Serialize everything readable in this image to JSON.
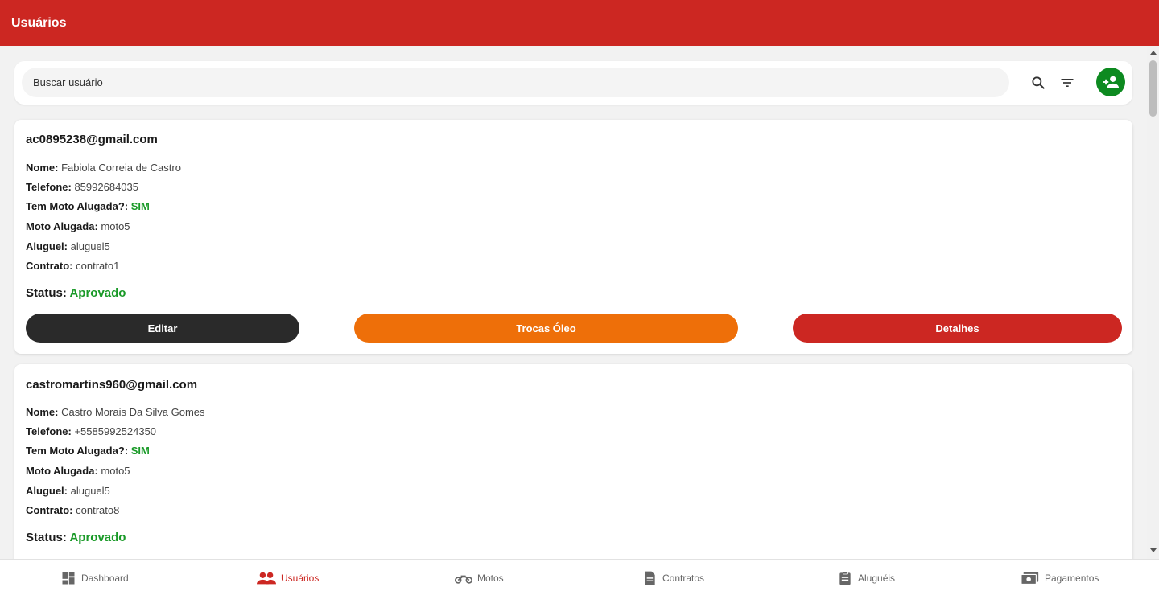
{
  "header": {
    "title": "Usuários"
  },
  "search": {
    "placeholder": "Buscar usuário"
  },
  "labels": {
    "nome": "Nome:",
    "telefone": "Telefone:",
    "tem_moto": "Tem Moto Alugada?:",
    "moto": "Moto Alugada:",
    "aluguel": "Aluguel:",
    "contrato": "Contrato:",
    "status": "Status:"
  },
  "buttons": {
    "edit": "Editar",
    "oil": "Trocas Óleo",
    "details": "Detalhes"
  },
  "users": [
    {
      "email": "ac0895238@gmail.com",
      "nome": "Fabiola Correia de Castro",
      "telefone": "85992684035",
      "tem_moto": "SIM",
      "moto": "moto5",
      "aluguel": "aluguel5",
      "contrato": "contrato1",
      "status": "Aprovado"
    },
    {
      "email": "castromartins960@gmail.com",
      "nome": "Castro Morais Da Silva Gomes",
      "telefone": "+5585992524350",
      "tem_moto": "SIM",
      "moto": "moto5",
      "aluguel": "aluguel5",
      "contrato": "contrato8",
      "status": "Aprovado"
    }
  ],
  "nav": {
    "items": [
      {
        "label": "Dashboard",
        "icon": "dashboard-icon"
      },
      {
        "label": "Usuários",
        "icon": "users-icon",
        "active": true
      },
      {
        "label": "Motos",
        "icon": "motorcycle-icon"
      },
      {
        "label": "Contratos",
        "icon": "document-icon"
      },
      {
        "label": "Aluguéis",
        "icon": "clipboard-icon"
      },
      {
        "label": "Pagamentos",
        "icon": "payments-icon"
      }
    ]
  },
  "colors": {
    "primary": "#cc2722",
    "accent": "#ee6f09",
    "success": "#1a9a28",
    "dark": "#2a2a2a"
  }
}
